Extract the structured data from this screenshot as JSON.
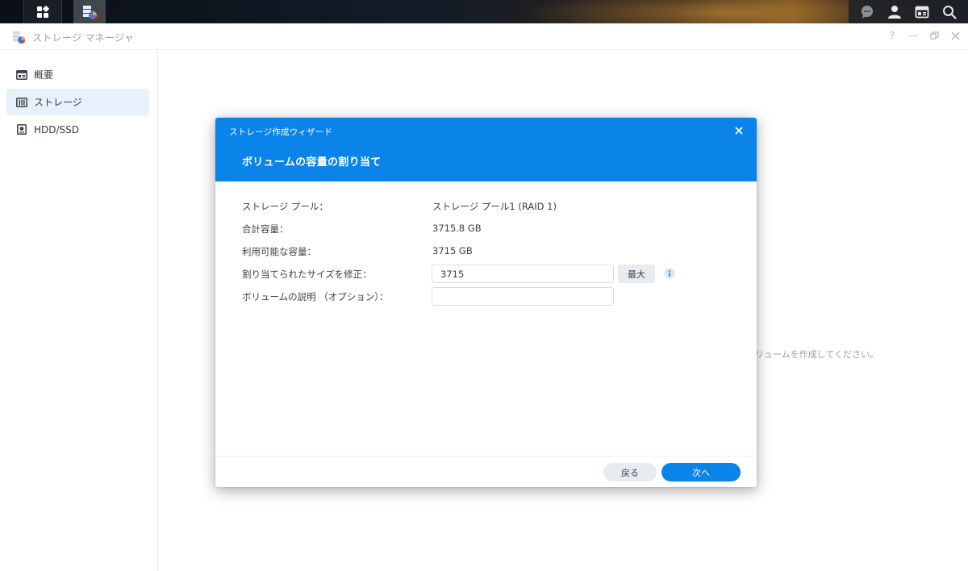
{
  "window": {
    "title": "ストレージ マネージャ",
    "controls": {
      "help": "?",
      "minimize": "—"
    }
  },
  "sidebar": {
    "items": [
      {
        "label": "概要",
        "icon": "overview-icon",
        "active": false
      },
      {
        "label": "ストレージ",
        "icon": "storage-icon",
        "active": true
      },
      {
        "label": "HDD/SSD",
        "icon": "disk-icon",
        "active": false
      }
    ]
  },
  "main": {
    "hint_text": "リュームを作成してください。"
  },
  "dialog": {
    "wizard_title": "ストレージ作成ウィザード",
    "step_title": "ボリュームの容量の割り当て",
    "fields": {
      "storage_pool": {
        "label": "ストレージ プール：",
        "value": "ストレージ プール1 (RAID 1)"
      },
      "total_capacity": {
        "label": "合計容量：",
        "value": "3715.8 GB"
      },
      "available_capacity": {
        "label": "利用可能な容量：",
        "value": "3715 GB"
      },
      "allocated_size": {
        "label": "割り当てられたサイズを修正：",
        "value": "3715",
        "max_button": "最大"
      },
      "description": {
        "label": "ボリュームの説明 （オプション）：",
        "value": ""
      }
    },
    "footer": {
      "back_label": "戻る",
      "next_label": "次へ"
    }
  },
  "colors": {
    "accent": "#0a84e8",
    "sidebar_active": "#e7f1fb",
    "text": "#3a3f46",
    "muted": "#9aa0a8"
  }
}
